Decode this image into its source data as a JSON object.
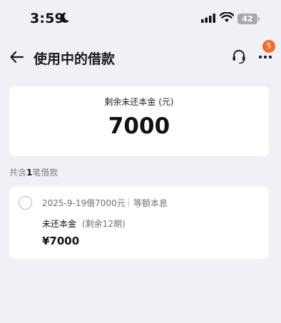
{
  "status_bar": {
    "time": "3:59",
    "battery": "42"
  },
  "nav": {
    "title": "使用中的借款",
    "badge_count": "5"
  },
  "summary": {
    "label": "剩余未还本金 (元)",
    "amount": "7000"
  },
  "loan_count": {
    "prefix": "共含",
    "count": "1",
    "suffix": "笔借款"
  },
  "loan": {
    "title": "2025-9-19借7000元",
    "method": "等额本息",
    "principal_label": "未还本金",
    "remaining_periods": "(剩余12期)",
    "principal_amount": "¥7000"
  },
  "colors": {
    "background": "#eff1f6",
    "badge": "#f36b2c",
    "muted_text": "#6a7080"
  }
}
